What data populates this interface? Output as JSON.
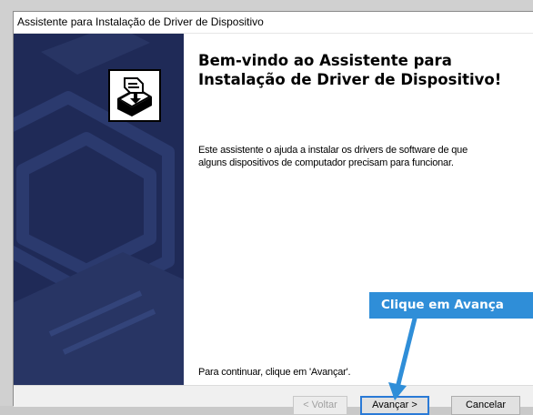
{
  "window": {
    "title": "Assistente para Instalação de Driver de Dispositivo"
  },
  "content": {
    "heading_line1": "Bem-vindo ao Assistente para",
    "heading_line2": "Instalação de Driver de Dispositivo!",
    "description": "Este assistente o ajuda a instalar os drivers de software de que alguns dispositivos de computador precisam para funcionar.",
    "continue_hint": "Para continuar, clique em 'Avançar'."
  },
  "buttons": {
    "back_label": "< Voltar",
    "next_label": "Avançar >",
    "cancel_label": "Cancelar"
  },
  "annotation": {
    "callout_text": "Clique em Avança"
  },
  "colors": {
    "banner": "#1f2a57",
    "callout": "#2f8ed8",
    "focus_border": "#2a7ad6"
  },
  "icons": [
    "device-driver-install-icon",
    "callout-arrow"
  ]
}
